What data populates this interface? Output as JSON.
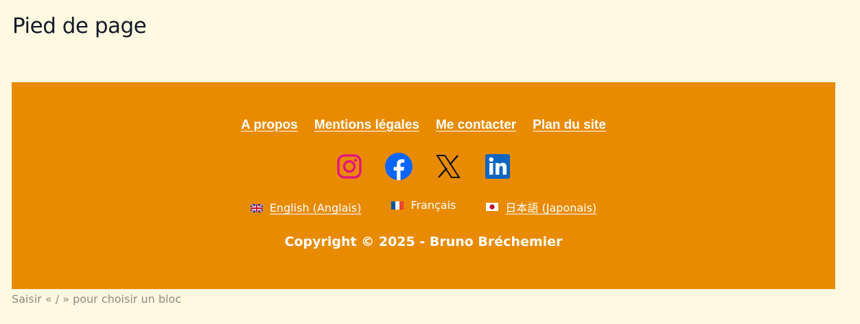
{
  "page": {
    "title": "Pied de page"
  },
  "footer": {
    "background_color": "#e88b00",
    "nav_links": [
      {
        "label": "A propos"
      },
      {
        "label": "Mentions légales"
      },
      {
        "label": "Me contacter"
      },
      {
        "label": "Plan du site"
      }
    ],
    "social_icons": [
      {
        "name": "instagram-icon"
      },
      {
        "name": "facebook-icon"
      },
      {
        "name": "x-icon"
      },
      {
        "name": "linkedin-icon"
      }
    ],
    "languages": [
      {
        "label": "English (Anglais)",
        "flag": "uk-flag-icon"
      },
      {
        "label": "Français",
        "flag": "france-flag-icon"
      },
      {
        "label": "日本語 (Japonais)",
        "flag": "japan-flag-icon"
      }
    ],
    "copyright": "Copyright © 2025 - Bruno Bréchemier"
  },
  "editor": {
    "block_hint": "Saisir « / » pour choisir un bloc"
  }
}
